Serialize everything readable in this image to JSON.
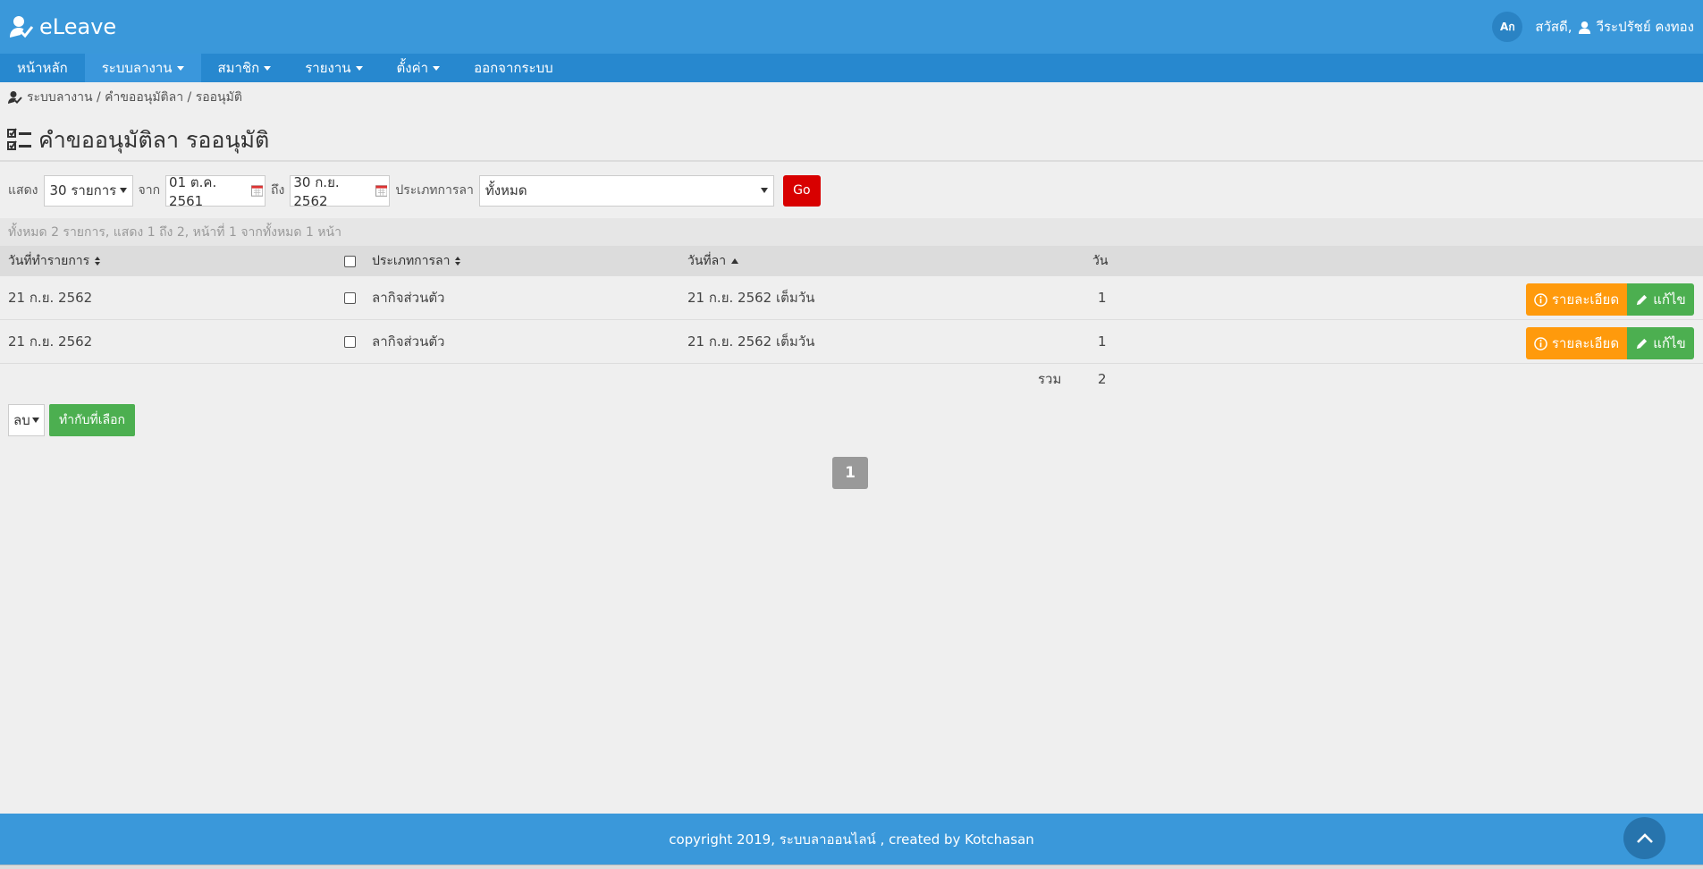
{
  "app": {
    "brand": "eLeave"
  },
  "header": {
    "lang_badge": "Aก",
    "greeting": "สวัสดี,",
    "user_name": "วีระปรัชย์ คงทอง"
  },
  "nav": {
    "items": [
      {
        "label": "หน้าหลัก",
        "has_menu": false
      },
      {
        "label": "ระบบลางาน",
        "has_menu": true
      },
      {
        "label": "สมาชิก",
        "has_menu": true
      },
      {
        "label": "รายงาน",
        "has_menu": true
      },
      {
        "label": "ตั้งค่า",
        "has_menu": true
      },
      {
        "label": "ออกจากระบบ",
        "has_menu": false
      }
    ]
  },
  "breadcrumb": {
    "text": "ระบบลางาน / คำขออนุมัติลา / รออนุมัติ"
  },
  "page": {
    "title": "คำขออนุมัติลา รออนุมัติ"
  },
  "filters": {
    "show_label": "แสดง",
    "show_value": "30 รายการ",
    "from_label": "จาก",
    "from_date": "01 ต.ค. 2561",
    "to_label": "ถึง",
    "to_date": "30 ก.ย. 2562",
    "type_label": "ประเภทการลา",
    "type_value": "ทั้งหมด",
    "go_label": "Go"
  },
  "summary": "ทั้งหมด 2 รายการ, แสดง 1 ถึง 2, หน้าที่ 1 จากทั้งหมด 1 หน้า",
  "table": {
    "columns": {
      "created": "วันที่ทำรายการ",
      "type": "ประเภทการลา",
      "leave_date": "วันที่ลา",
      "days": "วัน"
    },
    "rows": [
      {
        "created": "21 ก.ย. 2562",
        "type": "ลากิจส่วนตัว",
        "leave_date": "21 ก.ย. 2562 เต็มวัน",
        "days": "1"
      },
      {
        "created": "21 ก.ย. 2562",
        "type": "ลากิจส่วนตัว",
        "leave_date": "21 ก.ย. 2562 เต็มวัน",
        "days": "1"
      }
    ],
    "detail_label": "รายละเอียด",
    "edit_label": "แก้ไข",
    "total_label": "รวม",
    "total_value": "2"
  },
  "bulk": {
    "action_value": "ลบ",
    "apply_label": "ทำกับที่เลือก"
  },
  "pagination": {
    "current": "1"
  },
  "footer": {
    "text": "copyright 2019, ระบบลาออนไลน์ , created by Kotchasan"
  },
  "colors": {
    "header": "#3a98da",
    "navbar": "#2788cf",
    "go": "#d80000",
    "detail": "#ff9a0c",
    "edit": "#4caf50"
  }
}
